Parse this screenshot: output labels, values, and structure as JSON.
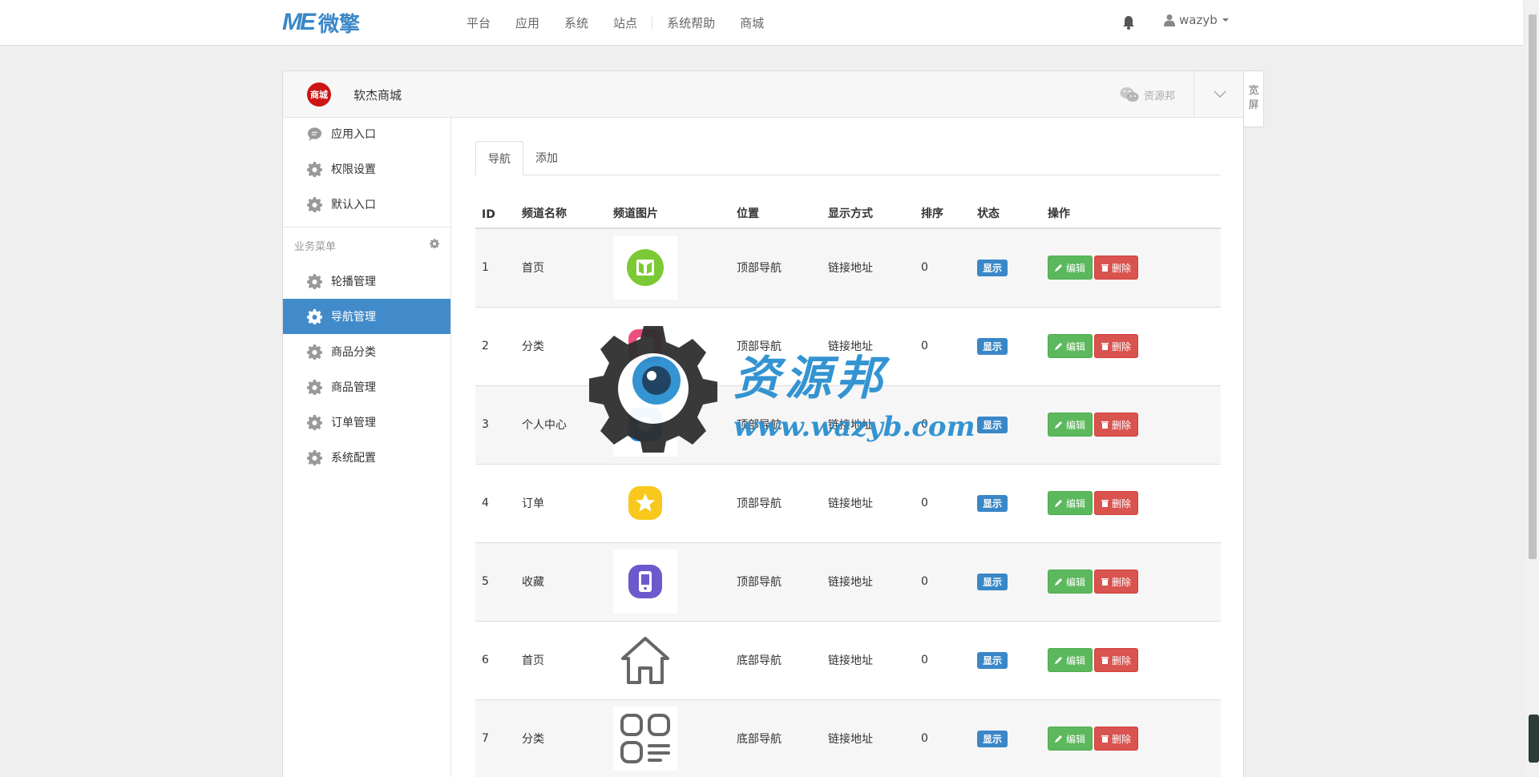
{
  "topbar": {
    "logo_mark": "ME",
    "logo_text": "微擎",
    "nav": [
      "平台",
      "应用",
      "系统",
      "站点",
      "系统帮助",
      "商城"
    ],
    "username": "wazyb"
  },
  "panel": {
    "shop_logo": "商城",
    "shop_name": "软杰商城",
    "wechat_label": "资源邦",
    "wide_label_1": "宽",
    "wide_label_2": "屏"
  },
  "sidebar": {
    "top_items": [
      {
        "label": "应用入口",
        "icon": "chat-icon"
      },
      {
        "label": "权限设置",
        "icon": "gear-icon"
      },
      {
        "label": "默认入口",
        "icon": "gear-icon"
      }
    ],
    "group_title": "业务菜单",
    "items": [
      {
        "label": "轮播管理",
        "active": false
      },
      {
        "label": "导航管理",
        "active": true
      },
      {
        "label": "商品分类",
        "active": false
      },
      {
        "label": "商品管理",
        "active": false
      },
      {
        "label": "订单管理",
        "active": false
      },
      {
        "label": "系统配置",
        "active": false
      }
    ]
  },
  "tabs": [
    "导航",
    "添加"
  ],
  "table": {
    "headers": [
      "ID",
      "频道名称",
      "频道图片",
      "位置",
      "显示方式",
      "排序",
      "状态",
      "操作"
    ],
    "rows": [
      {
        "id": "1",
        "name": "首页",
        "image": "book-app-icon",
        "position": "顶部导航",
        "display": "链接地址",
        "order": "0",
        "status": "显示"
      },
      {
        "id": "2",
        "name": "分类",
        "image": "pink-app-icon",
        "position": "顶部导航",
        "display": "链接地址",
        "order": "0",
        "status": "显示"
      },
      {
        "id": "3",
        "name": "个人中心",
        "image": "blue-app-icon",
        "position": "顶部导航",
        "display": "链接地址",
        "order": "0",
        "status": "显示"
      },
      {
        "id": "4",
        "name": "订单",
        "image": "star-app-icon",
        "position": "顶部导航",
        "display": "链接地址",
        "order": "0",
        "status": "显示"
      },
      {
        "id": "5",
        "name": "收藏",
        "image": "phone-app-icon",
        "position": "顶部导航",
        "display": "链接地址",
        "order": "0",
        "status": "显示"
      },
      {
        "id": "6",
        "name": "首页",
        "image": "home-outline-icon",
        "position": "底部导航",
        "display": "链接地址",
        "order": "0",
        "status": "显示"
      },
      {
        "id": "7",
        "name": "分类",
        "image": "grid-outline-icon",
        "position": "底部导航",
        "display": "链接地址",
        "order": "0",
        "status": "显示"
      }
    ],
    "edit_label": "编辑",
    "delete_label": "删除"
  },
  "watermark": {
    "title": "资源邦",
    "url": "www.wazyb.com"
  },
  "colors": {
    "primary": "#428bca",
    "success": "#5cb85c",
    "danger": "#d9534f",
    "badge": "#3a87c8"
  }
}
